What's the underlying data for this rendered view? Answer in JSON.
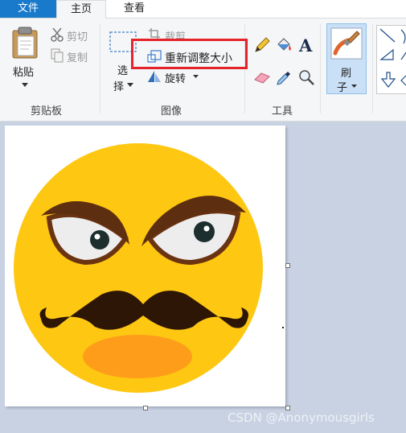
{
  "tabs": {
    "file": "文件",
    "home": "主页",
    "view": "查看"
  },
  "clipboard": {
    "paste": "粘贴",
    "cut": "剪切",
    "copy": "复制",
    "group_label": "剪贴板"
  },
  "image": {
    "select_line1": "选",
    "select_line2": "择",
    "crop": "裁剪",
    "resize": "重新调整大小",
    "rotate": "旋转",
    "group_label": "图像"
  },
  "tools": {
    "group_label": "工具"
  },
  "brushes": {
    "label_line1": "刷",
    "label_line2": "子"
  },
  "watermark": "CSDN @Anonymousgirls",
  "colors": {
    "file_tab": "#1979ca",
    "highlight": "#e5232b",
    "canvas_bg": "#c8d2e3",
    "face": "#fec712",
    "mouth": "#fd9d19"
  }
}
